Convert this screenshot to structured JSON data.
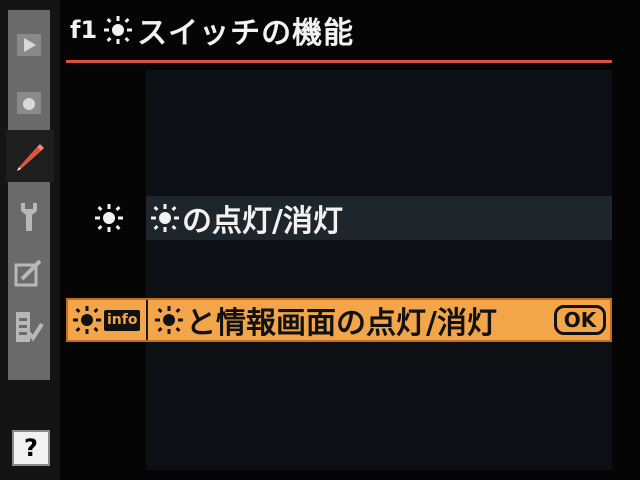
{
  "sidebar": {
    "items": [
      {
        "name": "playback-menu",
        "icon": "play-icon"
      },
      {
        "name": "shooting-menu",
        "icon": "camera-icon"
      },
      {
        "name": "custom-settings-menu",
        "icon": "pencil-icon",
        "active": true
      },
      {
        "name": "setup-menu",
        "icon": "wrench-icon"
      },
      {
        "name": "retouch-menu",
        "icon": "retouch-icon"
      },
      {
        "name": "my-menu",
        "icon": "my-menu-icon"
      }
    ],
    "help_label": "?"
  },
  "header": {
    "code": "f1",
    "title": "スイッチの機能"
  },
  "options": [
    {
      "label": "の点灯/消灯",
      "selected": false
    },
    {
      "label": "と情報画面の点灯/消灯",
      "selected": true,
      "info_tag": "info",
      "ok_label": "OK"
    }
  ],
  "colors": {
    "accent": "#d9503f",
    "highlight": "#f3a54a",
    "active_tab": "#d9503f"
  }
}
